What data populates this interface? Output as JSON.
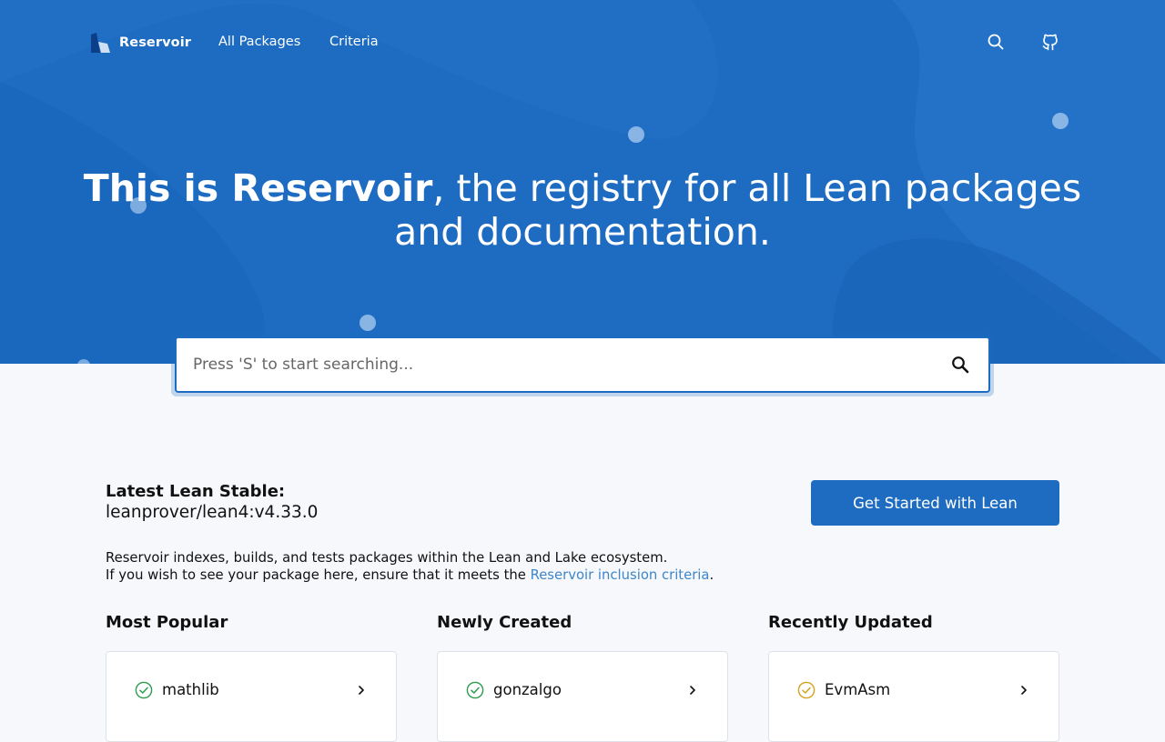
{
  "nav": {
    "brand": "Reservoir",
    "links": [
      "All Packages",
      "Criteria"
    ],
    "icons": [
      "search-icon",
      "github-icon"
    ]
  },
  "hero": {
    "title_bold": "This is Reservoir",
    "title_rest": ", the registry for all Lean packages and documentation."
  },
  "search": {
    "placeholder": "Press 'S' to start searching..."
  },
  "stable": {
    "label": "Latest Lean Stable:",
    "value": "leanprover/lean4:v4.33.0"
  },
  "cta": {
    "label": "Get Started with Lean"
  },
  "description": {
    "line1": "Reservoir indexes, builds, and tests packages within the Lean and Lake ecosystem.",
    "line2_prefix": "If you wish to see your package here, ensure that it meets the ",
    "link": "Reservoir inclusion criteria",
    "line2_suffix": "."
  },
  "columns": [
    {
      "title": "Most Popular",
      "items": [
        {
          "name": "mathlib",
          "status": "success"
        }
      ]
    },
    {
      "title": "Newly Created",
      "items": [
        {
          "name": "gonzalgo",
          "status": "success"
        }
      ]
    },
    {
      "title": "Recently Updated",
      "items": [
        {
          "name": "EvmAsm",
          "status": "warning"
        }
      ]
    }
  ],
  "colors": {
    "primary": "#1d6cc2",
    "success": "#2e9b4f",
    "warning": "#d4a21c",
    "link": "#3e86c9"
  }
}
